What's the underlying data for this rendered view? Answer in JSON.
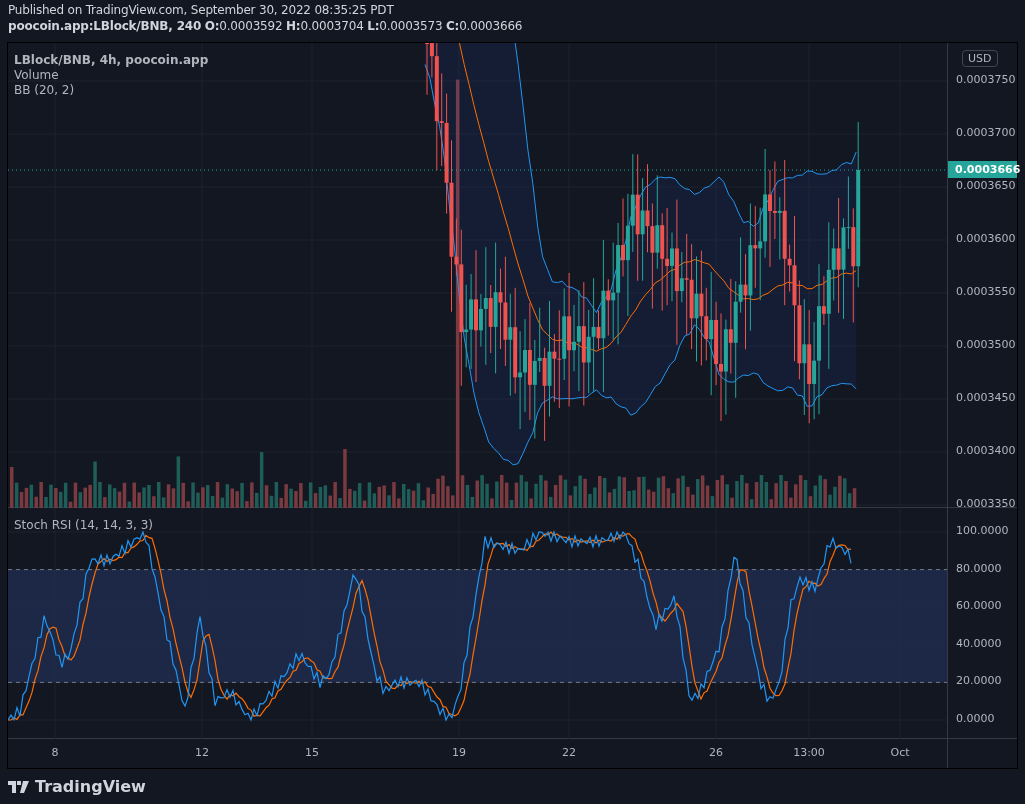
{
  "header": {
    "published": "Published on TradingView.com, September 30, 2022 08:35:25 PDT",
    "ohlc": "**poocoin.app:LBlock/BNB, 240** **O:**0.0003592 **H:**0.0003704 **L:**0.0003573 **C:**0.0003666"
  },
  "price_pane": {
    "legend": [
      "LBlock/BNB, 4h, poocoin.app",
      "Volume",
      "BB (20, 2)"
    ],
    "currency_button": "USD",
    "last_price": "0.0003666",
    "y_axis": [
      "0.0003750",
      "0.0003700",
      "0.0003650",
      "0.0003600",
      "0.0003550",
      "0.0003500",
      "0.0003450",
      "0.0003400",
      "0.0003350"
    ]
  },
  "stoch_pane": {
    "legend": "Stoch RSI (14, 14, 3, 3)",
    "y_axis": [
      "100.0000",
      "80.0000",
      "60.0000",
      "40.0000",
      "20.0000",
      "0.0000"
    ]
  },
  "time_axis": [
    "8",
    "12",
    "15",
    "19",
    "22",
    "26",
    "13:00",
    "Oct"
  ],
  "footer": {
    "logo": "TradingView"
  }
}
